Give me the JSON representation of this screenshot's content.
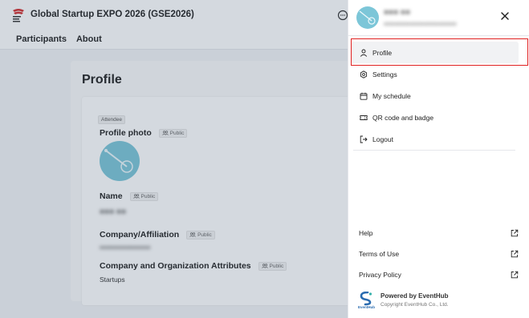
{
  "app": {
    "title": "Global Startup EXPO 2026 (GSE2026)",
    "nav": [
      "Participants",
      "About"
    ]
  },
  "page": {
    "title": "Profile",
    "role_badge": "Attendee",
    "public_label": "Public",
    "fields": {
      "photo_label": "Profile photo",
      "name_label": "Name",
      "name_value": "●●● ●●",
      "company_label": "Company/Affiliation",
      "company_value": "●●●●●●●●●●●●●●●",
      "attributes_label": "Company and Organization Attributes",
      "attributes_value": "Startups"
    }
  },
  "drawer": {
    "user_name": "●●● ●●",
    "user_sub": "●●●●●●●●●●●●●●●●●●●●",
    "menu": [
      {
        "label": "Profile",
        "icon": "user-icon",
        "active": true
      },
      {
        "label": "Settings",
        "icon": "gear-icon",
        "active": false
      },
      {
        "label": "My schedule",
        "icon": "calendar-icon",
        "active": false
      },
      {
        "label": "QR code and badge",
        "icon": "ticket-icon",
        "active": false
      },
      {
        "label": "Logout",
        "icon": "logout-icon",
        "active": false
      }
    ],
    "links": [
      {
        "label": "Help",
        "icon": "external-link-icon"
      },
      {
        "label": "Terms of Use",
        "icon": "external-link-icon"
      },
      {
        "label": "Privacy Policy",
        "icon": "external-link-icon"
      }
    ],
    "powered_by": "Powered by EventHub",
    "copyright": "Copyright EventHub Co., Ltd.",
    "logo_text": "EventHub"
  },
  "colors": {
    "highlight": "#e02020",
    "avatar": "#7cc6d8",
    "brand_red": "#d32f2f"
  }
}
